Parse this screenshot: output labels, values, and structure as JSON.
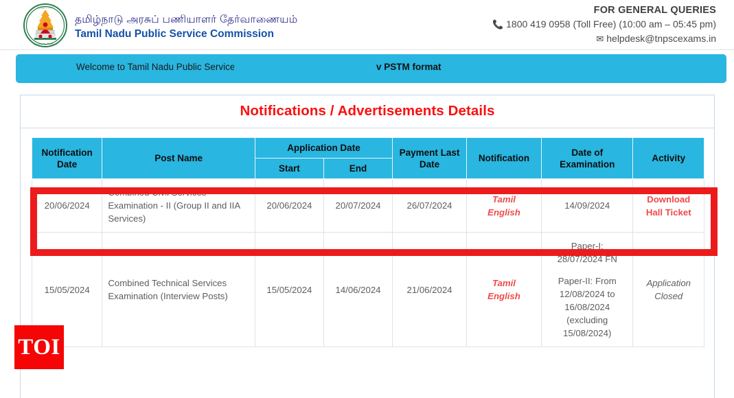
{
  "header": {
    "brand_tamil": "தமிழ்நாடு அரசுப் பணியாளர் தேர்வாணையம்",
    "brand_english": "Tamil Nadu Public Service Commission",
    "emblem_name": "tamil-nadu-state-emblem",
    "queries_title": "FOR GENERAL QUERIES",
    "phone_icon": "phone-icon",
    "phone_text": "1800 419 0958 (Toll Free)  (10:00 am – 05:45 pm)",
    "email_icon": "envelope-icon",
    "email_text": "helpdesk@tnpscexams.in"
  },
  "banner": {
    "marquee_left": "Welcome to Tamil Nadu Public Service",
    "marquee_right": "v PSTM format",
    "background_color": "#29b6e0"
  },
  "panel": {
    "title": "Notifications / Advertisements Details",
    "title_color": "#fb0f0f"
  },
  "table": {
    "header": {
      "notification_date": "Notification Date",
      "post_name": "Post Name",
      "application_date": "Application Date",
      "start": "Start",
      "end": "End",
      "payment_last_date": "Payment Last Date",
      "notification": "Notification",
      "date_of_examination": "Date of Examination",
      "activity": "Activity",
      "background_color": "#29b6e0"
    },
    "rows": [
      {
        "notification_date": "20/06/2024",
        "post_name": "Combined Civil Services Examination - II (Group II and IIA Services)",
        "start": "20/06/2024",
        "end": "20/07/2024",
        "payment_last_date": "26/07/2024",
        "notification_tamil": "Tamil",
        "notification_english": "English",
        "exam_line_1": "14/09/2024",
        "exam_line_2": "",
        "activity": "Download Hall Ticket",
        "activity_state": "link",
        "highlighted": true
      },
      {
        "notification_date": "15/05/2024",
        "post_name": "Combined Technical Services Examination (Interview Posts)",
        "start": "15/05/2024",
        "end": "14/06/2024",
        "payment_last_date": "21/06/2024",
        "notification_tamil": "Tamil",
        "notification_english": "English",
        "exam_line_1": "Paper-I: 28/07/2024 FN",
        "exam_line_2": "Paper-II: From 12/08/2024 to 16/08/2024 (excluding 15/08/2024)",
        "activity": "Application Closed",
        "activity_state": "closed",
        "highlighted": false
      }
    ]
  },
  "annotation": {
    "highlight_box_color": "#ed1c1c"
  },
  "watermark": {
    "text": "TOI",
    "background_color": "#f50505",
    "text_color": "#ffffff"
  }
}
